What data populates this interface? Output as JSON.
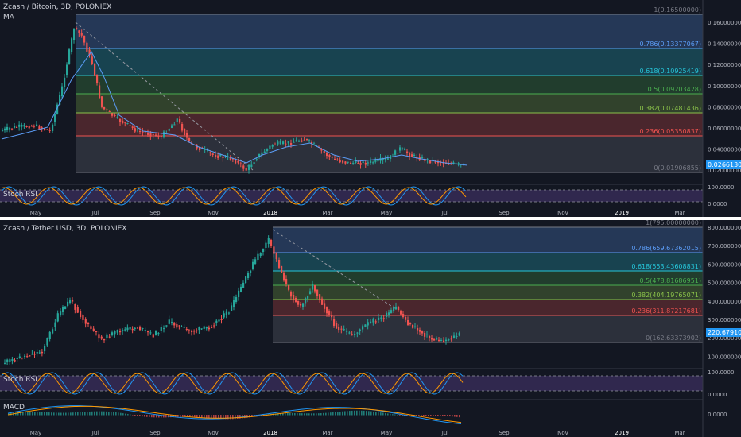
{
  "top_chart": {
    "title": "Zcash / Bitcoin, 3D, POLONIEX",
    "indicator": "MA",
    "fib_levels": [
      {
        "ratio": "1",
        "value": "0.16500000",
        "label": "1(0.16500000)",
        "color": "#787b86"
      },
      {
        "ratio": "0.786",
        "value": "0.13377067",
        "label": "0.786(0.13377067)",
        "color": "#5b9cf6"
      },
      {
        "ratio": "0.618",
        "value": "0.10925419",
        "label": "0.618(0.10925419)",
        "color": "#26c6da"
      },
      {
        "ratio": "0.5",
        "value": "0.09203428",
        "label": "0.5(0.09203428)",
        "color": "#4caf50"
      },
      {
        "ratio": "0.382",
        "value": "0.07481436",
        "label": "0.382(0.07481436)",
        "color": "#8bc34a"
      },
      {
        "ratio": "0.236",
        "value": "0.05350837",
        "label": "0.236(0.05350837)",
        "color": "#ef5350"
      },
      {
        "ratio": "0",
        "value": "0.01906855",
        "label": "0(0.01906855)",
        "color": "#787b86"
      }
    ],
    "y_ticks": [
      "0.16000000",
      "0.14000000",
      "0.12000000",
      "0.10000000",
      "0.08000000",
      "0.06000000",
      "0.04000000",
      "0.02000000"
    ],
    "current_price": "0.02661300",
    "rsi_label": "Stoch RSI",
    "rsi_ticks": [
      "100.0000",
      "0.0000"
    ]
  },
  "bottom_chart": {
    "title": "Zcash / Tether USD, 3D, POLONIEX",
    "fib_levels": [
      {
        "ratio": "1",
        "value": "795.00000000",
        "label": "1(795.00000000)",
        "color": "#787b86"
      },
      {
        "ratio": "0.786",
        "value": "659.67362015",
        "label": "0.786(659.67362015)",
        "color": "#5b9cf6"
      },
      {
        "ratio": "0.618",
        "value": "553.43608831",
        "label": "0.618(553.43608831)",
        "color": "#26c6da"
      },
      {
        "ratio": "0.5",
        "value": "478.81686951",
        "label": "0.5(478.81686951)",
        "color": "#4caf50"
      },
      {
        "ratio": "0.382",
        "value": "404.19765071",
        "label": "0.382(404.19765071)",
        "color": "#8bc34a"
      },
      {
        "ratio": "0.236",
        "value": "311.87217681",
        "label": "0.236(311.87217681)",
        "color": "#ef5350"
      },
      {
        "ratio": "0",
        "value": "162.63373902",
        "label": "0(162.63373902)",
        "color": "#787b86"
      }
    ],
    "y_ticks": [
      "800.00000000",
      "700.00000000",
      "600.00000000",
      "500.00000000",
      "400.00000000",
      "300.00000000",
      "200.00000000",
      "100.00000000"
    ],
    "current_price": "220.67910007",
    "rsi_label": "Stoch RSI",
    "rsi_ticks": [
      "100.0000",
      "0.0000"
    ],
    "macd_label": "MACD",
    "macd_ticks": [
      "0.0000"
    ]
  },
  "x_axis": [
    "May",
    "Jul",
    "Sep",
    "Nov",
    "2018",
    "Mar",
    "May",
    "Jul",
    "Sep",
    "Nov",
    "2019",
    "Mar"
  ],
  "colors": {
    "background": "#131722",
    "up_candle": "#26a69a",
    "down_candle": "#ef5350",
    "ma_line": "#5b9cf6",
    "stoch_k": "#2196f3",
    "stoch_d": "#ff9800",
    "rsi_band": "#7e57c2",
    "trend_line": "#9598a1"
  }
}
